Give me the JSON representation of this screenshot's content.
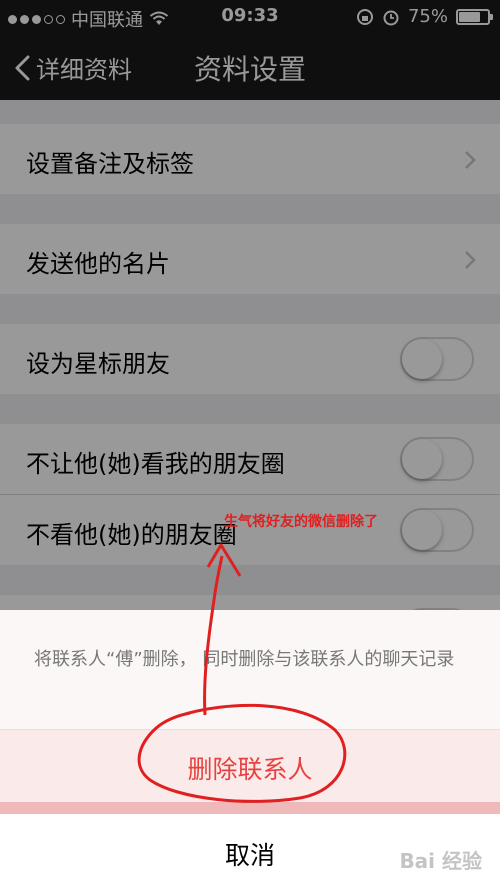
{
  "status_bar": {
    "carrier": "中国联通",
    "time": "09:33",
    "battery_text": "75%",
    "battery_level": 0.75,
    "icons": [
      "signal-dots-icon",
      "wifi-icon",
      "rotation-lock-icon",
      "alarm-icon",
      "battery-icon"
    ]
  },
  "nav": {
    "back_label": "详细资料",
    "title": "资料设置"
  },
  "rows": {
    "remark": "设置备注及标签",
    "send_card": "发送他的名片",
    "star": "设为星标朋友",
    "no_view_mine": "不让他(她)看我的朋友圈",
    "no_view_his": "不看他(她)的朋友圈"
  },
  "action_sheet": {
    "message": "将联系人“傅”删除， 同时删除与该联系人的聊天记录",
    "delete_label": "删除联系人",
    "cancel_label": "取消"
  },
  "annotation": {
    "text": "生气将好友的微信删除了",
    "color": "#e02020"
  },
  "watermark": "Bai 经验",
  "colors": {
    "destructive": "#e64340",
    "nav_bg": "#1a1a1a"
  }
}
